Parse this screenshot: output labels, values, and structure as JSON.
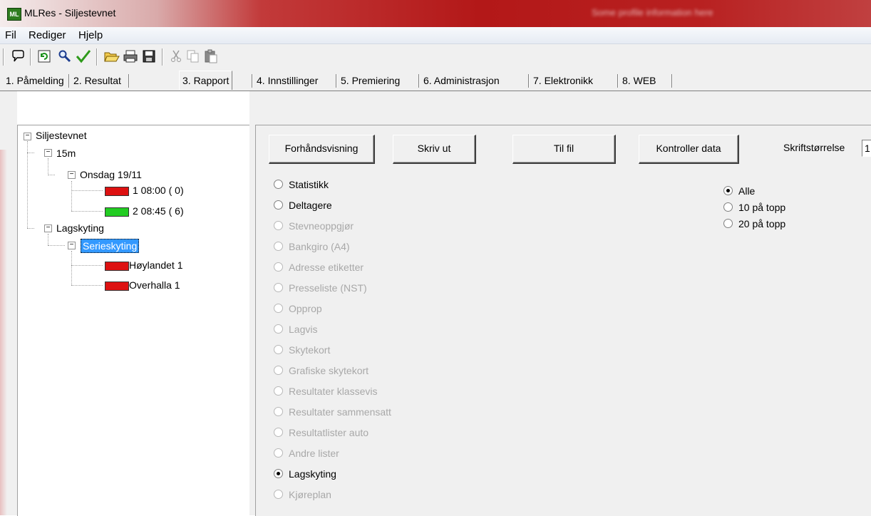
{
  "window": {
    "title": "MLRes - Siljestevnet",
    "blurred_text": "Some profile information here"
  },
  "menu": {
    "items": [
      "Fil",
      "Rediger",
      "Hjelp"
    ]
  },
  "toolbar": {
    "icons": [
      "help-pointer-icon",
      "refresh-icon",
      "search-icon",
      "check-icon",
      "open-folder-icon",
      "print-icon",
      "save-icon",
      "cut-icon",
      "copy-icon",
      "paste-icon"
    ]
  },
  "tabs": [
    {
      "label": "1. Påmelding"
    },
    {
      "label": "2. Resultat"
    },
    {
      "label": "3. Rapport",
      "active": true
    },
    {
      "label": "4. Innstillinger"
    },
    {
      "label": "5. Premiering"
    },
    {
      "label": "6. Administrasjon"
    },
    {
      "label": "7. Elektronikk"
    },
    {
      "label": "8. WEB"
    }
  ],
  "tree": {
    "root": "Siljestevnet",
    "n15m": "15m",
    "onsdag": "Onsdag 19/11",
    "lag1": "1 08:00  ( 0)",
    "lag2": "2 08:45  ( 6)",
    "lagskyting": "Lagskyting",
    "serieskyting": "Serieskyting",
    "hoylandet": "Høylandet 1",
    "overhalla": "Overhalla 1",
    "status_colors": {
      "red": "#dd1111",
      "green": "#22cc22"
    }
  },
  "buttons": {
    "preview": "Forhåndsvisning",
    "print": "Skriv ut",
    "to_file": "Til fil",
    "check_data": "Kontroller data"
  },
  "font_size": {
    "label": "Skriftstørrelse",
    "value": "1"
  },
  "reports": [
    {
      "label": "Statistikk",
      "enabled": true,
      "checked": false
    },
    {
      "label": "Deltagere",
      "enabled": true,
      "checked": false
    },
    {
      "label": "Stevneoppgjør",
      "enabled": false,
      "checked": false
    },
    {
      "label": "Bankgiro (A4)",
      "enabled": false,
      "checked": false
    },
    {
      "label": "Adresse etiketter",
      "enabled": false,
      "checked": false
    },
    {
      "label": "Presseliste (NST)",
      "enabled": false,
      "checked": false
    },
    {
      "label": "Opprop",
      "enabled": false,
      "checked": false
    },
    {
      "label": "Lagvis",
      "enabled": false,
      "checked": false
    },
    {
      "label": "Skytekort",
      "enabled": false,
      "checked": false
    },
    {
      "label": "Grafiske skytekort",
      "enabled": false,
      "checked": false
    },
    {
      "label": "Resultater klassevis",
      "enabled": false,
      "checked": false
    },
    {
      "label": "Resultater sammensatt",
      "enabled": false,
      "checked": false
    },
    {
      "label": "Resultatlister auto",
      "enabled": false,
      "checked": false
    },
    {
      "label": "Andre lister",
      "enabled": false,
      "checked": false
    },
    {
      "label": "Lagskyting",
      "enabled": true,
      "checked": true
    },
    {
      "label": "Kjøreplan",
      "enabled": false,
      "checked": false
    }
  ],
  "scope": [
    {
      "label": "Alle",
      "checked": true
    },
    {
      "label": "10 på topp",
      "checked": false
    },
    {
      "label": "20 på topp",
      "checked": false
    }
  ]
}
